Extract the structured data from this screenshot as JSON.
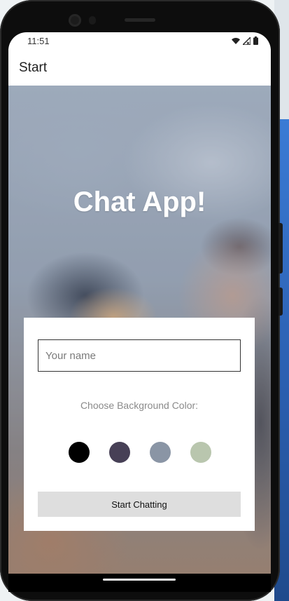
{
  "status_bar": {
    "time": "11:51",
    "icons": [
      "wifi-icon",
      "signal-icon",
      "battery-icon"
    ]
  },
  "app_bar": {
    "title": "Start"
  },
  "hero": {
    "title": "Chat App!"
  },
  "form": {
    "name_placeholder": "Your name",
    "color_label": "Choose Background Color:",
    "colors": [
      "#000000",
      "#474056",
      "#8a95a5",
      "#b9c6ae"
    ],
    "start_label": "Start Chatting"
  }
}
